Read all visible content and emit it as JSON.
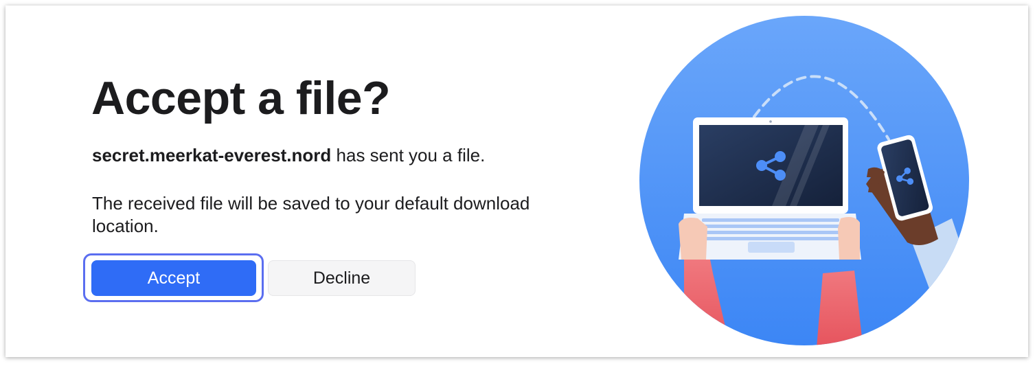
{
  "dialog": {
    "title": "Accept a file?",
    "sender_name": "secret.meerkat-everest.nord",
    "sender_suffix": " has sent you a file.",
    "save_note": "The received file will be saved to your default download location.",
    "accept_label": "Accept",
    "decline_label": "Decline"
  },
  "illustration": {
    "icon_name": "file-sharing-illustration",
    "share_icon": "share-icon"
  },
  "colors": {
    "accent": "#2f6cf6",
    "focus_ring": "#5b6ef0",
    "circle_bg": "#5b9bf8",
    "text": "#1c1c1e"
  }
}
